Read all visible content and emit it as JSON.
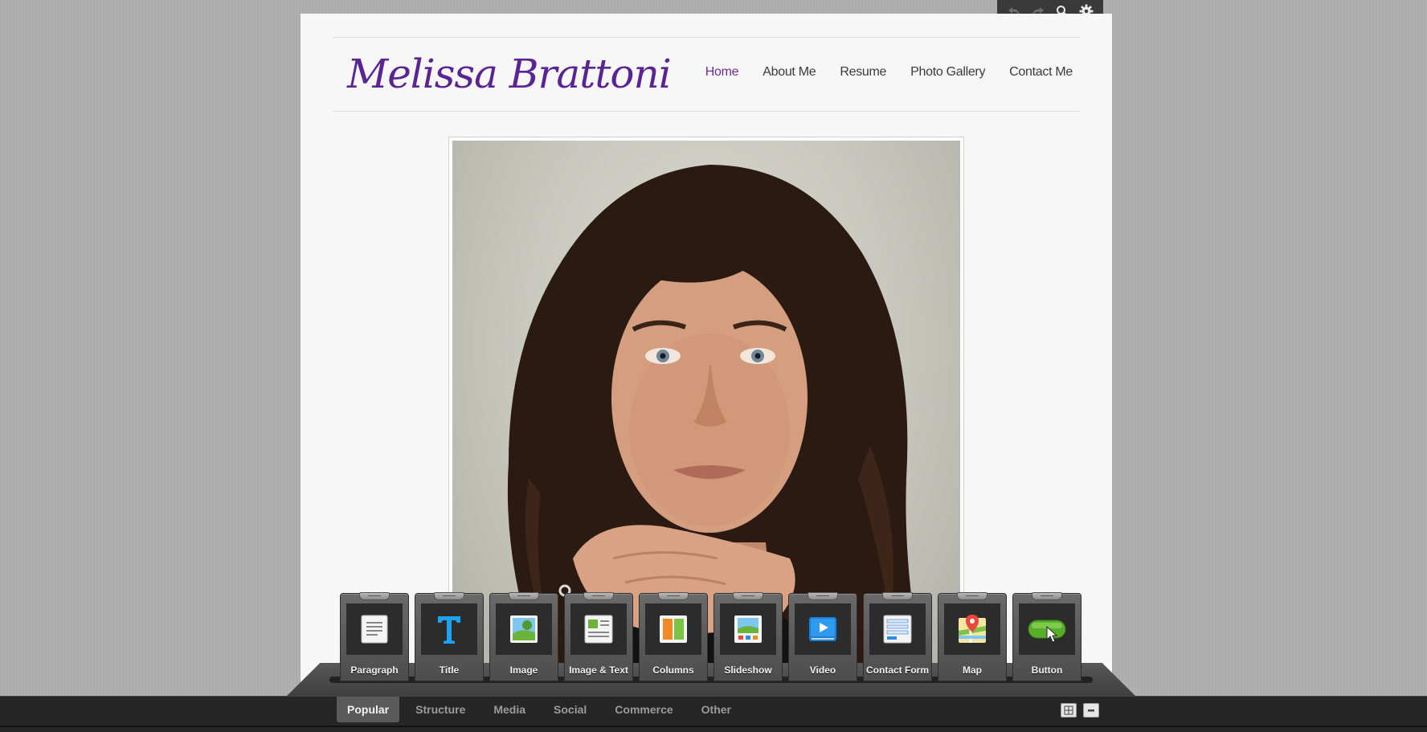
{
  "editor_toolbar": {
    "buttons": [
      {
        "icon": "undo-icon"
      },
      {
        "icon": "redo-icon"
      },
      {
        "icon": "search-icon"
      },
      {
        "icon": "gear-icon"
      }
    ]
  },
  "site": {
    "title": "Melissa Brattoni",
    "title_color": "#5b2494",
    "nav": [
      {
        "label": "Home",
        "active": true
      },
      {
        "label": "About Me",
        "active": false
      },
      {
        "label": "Resume",
        "active": false
      },
      {
        "label": "Photo Gallery",
        "active": false
      },
      {
        "label": "Contact Me",
        "active": false
      }
    ]
  },
  "widgets": [
    {
      "label": "Paragraph",
      "icon": "paragraph-icon"
    },
    {
      "label": "Title",
      "icon": "title-icon"
    },
    {
      "label": "Image",
      "icon": "image-icon"
    },
    {
      "label": "Image & Text",
      "icon": "image-text-icon"
    },
    {
      "label": "Columns",
      "icon": "columns-icon"
    },
    {
      "label": "Slideshow",
      "icon": "slideshow-icon"
    },
    {
      "label": "Video",
      "icon": "video-icon"
    },
    {
      "label": "Contact Form",
      "icon": "contact-form-icon"
    },
    {
      "label": "Map",
      "icon": "map-icon"
    },
    {
      "label": "Button",
      "icon": "button-icon"
    }
  ],
  "categories": [
    {
      "label": "Popular",
      "active": true
    },
    {
      "label": "Structure",
      "active": false
    },
    {
      "label": "Media",
      "active": false
    },
    {
      "label": "Social",
      "active": false
    },
    {
      "label": "Commerce",
      "active": false
    },
    {
      "label": "Other",
      "active": false
    }
  ],
  "bar_controls": [
    {
      "icon": "grid-icon"
    },
    {
      "icon": "minimize-icon"
    }
  ]
}
